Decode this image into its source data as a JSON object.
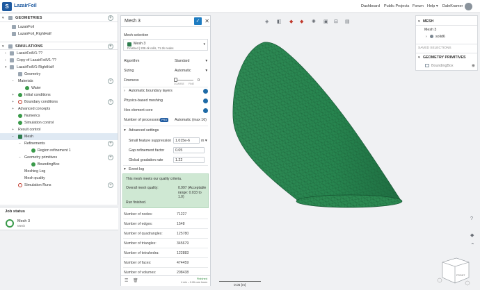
{
  "topbar": {
    "title": "LazairFoil",
    "nav": [
      "Dashboard",
      "Public Projects",
      "Forum",
      "Help ▾",
      "DaleKramer"
    ]
  },
  "geometries": {
    "title": "GEOMETRIES",
    "items": [
      "LazairFoil",
      "LazairFoil_RightHalf"
    ]
  },
  "simulations": {
    "title": "SIMULATIONS",
    "items": [
      "LazairFoilV1-??",
      "Copy of LazairFoilV1-??",
      "LazairFoilV1-RightHalf"
    ]
  },
  "tree": {
    "geometry": "Geometry",
    "materials": "Materials",
    "water": "Water",
    "initial": "Initial conditions",
    "boundary": "Boundary conditions",
    "advanced": "Advanced concepts",
    "numerics": "Numerics",
    "simcontrol": "Simulation control",
    "result": "Result control",
    "mesh": "Mesh",
    "refinements": "Refinements",
    "region": "Region refinement 1",
    "primitives": "Geometry primitives",
    "bbox": "BoundingBox",
    "meshlog": "Meshing Log",
    "meshquality": "Mesh quality",
    "runs": "Simulation Runs"
  },
  "job": {
    "title": "Job status",
    "name": "Mesh 3",
    "sub": "Mesh"
  },
  "panel": {
    "title": "Mesh 3",
    "selection_label": "Mesh selection",
    "mesh_name": "Mesh 3",
    "mesh_info": "Finished | 208.4k cells, 71.2k nodes",
    "algorithm_label": "Algorithm",
    "algorithm": "Standard",
    "sizing_label": "Sizing",
    "sizing": "Automatic",
    "fineness_label": "Fineness",
    "fineness": "0",
    "coarse": "COARSE",
    "fine": "FINE",
    "auto_bl": "Automatic boundary layers",
    "physics": "Physics-based meshing",
    "hex": "Hex element core",
    "procs_label": "Number of processors",
    "pro": "PRO",
    "procs": "Automatic (max 16)",
    "adv_settings": "Advanced settings",
    "sfs_label": "Small feature suppression",
    "sfs": "1.015e-6",
    "sfs_unit": "m ▾",
    "gap_label": "Gap refinement factor",
    "gap": "0.05",
    "grad_label": "Global gradation rate",
    "grad": "1.22",
    "event_log": "Event log",
    "q1": "This mesh meets our quality criteria.",
    "q2_label": "Overall mesh quality:",
    "q2": "0.997 (Acceptable",
    "q2b": "range: 0.033 to 1.0)",
    "q3": "Run finished.",
    "stats": [
      [
        "Number of nodes:",
        "71227"
      ],
      [
        "Number of edges:",
        "1548"
      ],
      [
        "Number of quadrangles:",
        "125780"
      ],
      [
        "Number of triangles:",
        "345679"
      ],
      [
        "Number of tetrahedra:",
        "122883"
      ],
      [
        "Number of faces:",
        "474459"
      ],
      [
        "Number of volumes:",
        "208438"
      ]
    ],
    "finished": "Finished",
    "time": "4 min – 0.26 core hours"
  },
  "rightpanel": {
    "mesh_title": "MESH",
    "mesh_name": "Mesh 3",
    "solid": "solid6",
    "saved": "SAVED SELECTIONS",
    "prims": "GEOMETRY PRIMITIVES",
    "bbox": "BoundingBox"
  },
  "viewport": {
    "scale": "0.05 [m]",
    "cube": "FRONT"
  }
}
